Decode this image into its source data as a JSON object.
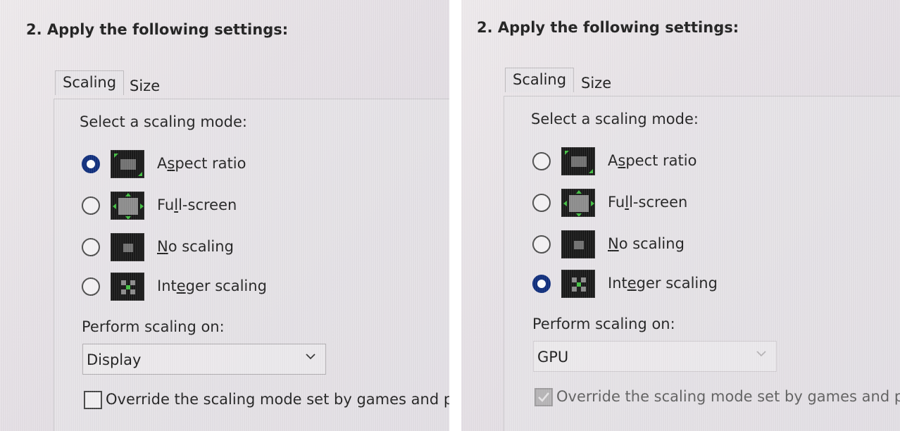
{
  "panels": [
    {
      "heading": "2. Apply the following settings:",
      "tabs": [
        "Scaling",
        "Size"
      ],
      "select_mode_label": "Select a scaling mode:",
      "modes": [
        {
          "pre": "A",
          "key": "s",
          "post": "pect ratio",
          "icon": "aspect-ratio-icon",
          "checked": true
        },
        {
          "pre": "Fu",
          "key": "l",
          "post": "l-screen",
          "icon": "full-screen-icon",
          "checked": false
        },
        {
          "pre": "",
          "key": "N",
          "post": "o scaling",
          "icon": "no-scaling-icon",
          "checked": false
        },
        {
          "pre": "Int",
          "key": "e",
          "post": "ger scaling",
          "icon": "integer-scaling-icon",
          "checked": false
        }
      ],
      "perform_label": "Perform scaling on:",
      "dropdown_value": "Display",
      "dropdown_disabled": false,
      "override_label": "Override the scaling mode set by games and pro",
      "override_checked": false,
      "override_disabled": false
    },
    {
      "heading": "2. Apply the following settings:",
      "tabs": [
        "Scaling",
        "Size"
      ],
      "select_mode_label": "Select a scaling mode:",
      "modes": [
        {
          "pre": "A",
          "key": "s",
          "post": "pect ratio",
          "icon": "aspect-ratio-icon",
          "checked": false
        },
        {
          "pre": "Fu",
          "key": "l",
          "post": "l-screen",
          "icon": "full-screen-icon",
          "checked": false
        },
        {
          "pre": "",
          "key": "N",
          "post": "o scaling",
          "icon": "no-scaling-icon",
          "checked": false
        },
        {
          "pre": "Int",
          "key": "e",
          "post": "ger scaling",
          "icon": "integer-scaling-icon",
          "checked": true
        }
      ],
      "perform_label": "Perform scaling on:",
      "dropdown_value": "GPU",
      "dropdown_disabled": true,
      "override_label": "Override the scaling mode set by games and pro",
      "override_checked": true,
      "override_disabled": true
    }
  ],
  "colors": {
    "radio_selected": "#0b2a7a",
    "icon_arrow_green": "#3fbf3f",
    "icon_bg": "#141414"
  }
}
